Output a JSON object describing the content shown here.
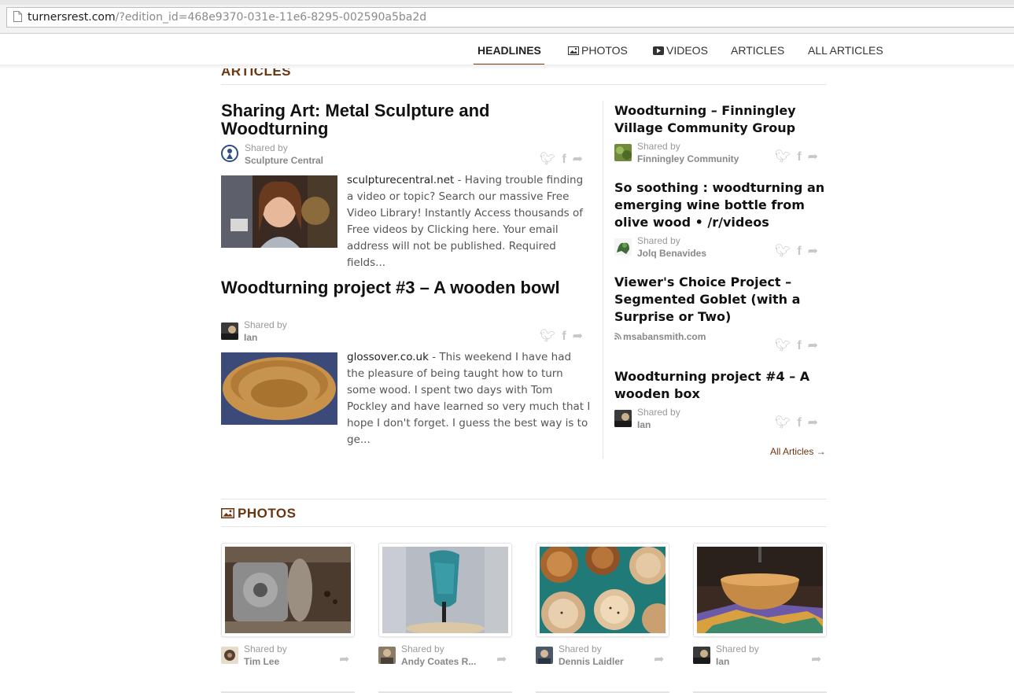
{
  "browser": {
    "url_host": "turnersrest.com",
    "url_path": "/?edition_id=468e9370-031e-11e6-8295-002590a5ba2d"
  },
  "nav": {
    "items": [
      {
        "label": "HEADLINES"
      },
      {
        "label": "PHOTOS",
        "icon": "image-icon"
      },
      {
        "label": "VIDEOS",
        "icon": "play-icon"
      },
      {
        "label": "ARTICLES"
      },
      {
        "label": "ALL ARTICLES"
      }
    ],
    "active": "HEADLINES"
  },
  "articles_section": {
    "title": "ARTICLES",
    "main": [
      {
        "title": "Sharing Art: Metal Sculpture and Woodturning",
        "shared_label": "Shared by",
        "shared_by": "Sculpture Central",
        "source": "sculpturecentral.net",
        "excerpt": " - Having trouble finding a video or topic? Search our massive Free Video Library! Instantly Access thousands of Free videos by Clicking here. Your email address will not be published. Required fields..."
      },
      {
        "title": "Woodturning project #3 – A wooden bowl",
        "shared_label": "Shared by",
        "shared_by": "Ian",
        "source": "glossover.co.uk",
        "excerpt": " - This weekend I have had the pleasure of being taught how to turn some wood. I spent two days with Tom Pockley and have learned so very much that I hope I don't forget. I guess the best way is to ge..."
      }
    ],
    "side": [
      {
        "title": "Woodturning – Finningley Village Community Group",
        "shared_label": "Shared by",
        "shared_by": "Finningley Community"
      },
      {
        "title": "So soothing : woodturning an emerging wine bottle from olive wood • /r/videos",
        "shared_label": "Shared by",
        "shared_by": "Jolq Benavides"
      },
      {
        "title": "Viewer's Choice Project – Segmented Goblet (with a Surprise or Two)",
        "feed_source": "msabansmith.com"
      },
      {
        "title": "Woodturning project #4 – A wooden box",
        "shared_label": "Shared by",
        "shared_by": "Ian"
      }
    ],
    "all_link": "All Articles →"
  },
  "photos_section": {
    "title": "PHOTOS",
    "items": [
      {
        "shared_label": "Shared by",
        "shared_by": "Tim Lee"
      },
      {
        "shared_label": "Shared by",
        "shared_by": "Andy Coates R..."
      },
      {
        "shared_label": "Shared by",
        "shared_by": "Dennis Laidler"
      },
      {
        "shared_label": "Shared by",
        "shared_by": "Ian"
      }
    ]
  },
  "icons": {
    "twitter": "twitter-icon",
    "facebook": "facebook-icon",
    "share": "share-icon",
    "rss": "rss-icon"
  },
  "colors": {
    "accent": "#7a3b12",
    "section_title": "#6b3510"
  }
}
